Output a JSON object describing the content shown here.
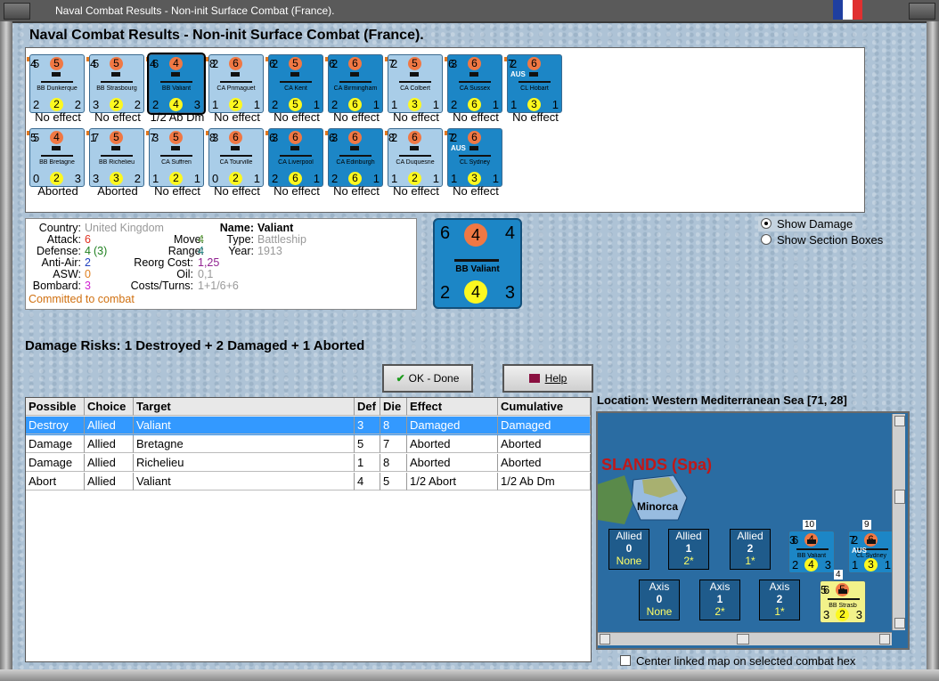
{
  "window": {
    "title": "Naval Combat Results - Non-init Surface Combat (France).",
    "flag_colors": [
      "#1f3fa0",
      "#ffffff",
      "#e03030"
    ]
  },
  "heading": "Naval Combat Results - Non-init Surface Combat (France).",
  "row1": [
    {
      "tl": "5",
      "att": "5",
      "tr": "4",
      "name": "BB Dunkerque",
      "bl": "2",
      "def": "2",
      "br": "2",
      "result": "No effect",
      "style": "light",
      "selected": false
    },
    {
      "tl": "5",
      "att": "5",
      "tr": "4",
      "name": "BB Strasbourg",
      "bl": "3",
      "def": "2",
      "br": "2",
      "result": "No effect",
      "style": "light",
      "selected": false
    },
    {
      "tl": "6",
      "att": "4",
      "tr": "4",
      "name": "BB Valiant",
      "bl": "2",
      "def": "4",
      "br": "3",
      "result": "1/2 Ab Dm",
      "style": "dark",
      "selected": true
    },
    {
      "tl": "2",
      "att": "6",
      "tr": "8",
      "name": "CA Primaguet",
      "bl": "1",
      "def": "2",
      "br": "1",
      "result": "No effect",
      "style": "light",
      "selected": false
    },
    {
      "tl": "2",
      "att": "5",
      "tr": "6",
      "name": "CA Kent",
      "bl": "2",
      "def": "5",
      "br": "1",
      "result": "No effect",
      "style": "dark",
      "selected": false
    },
    {
      "tl": "2",
      "att": "6",
      "tr": "6",
      "name": "CA Birmingham",
      "bl": "2",
      "def": "6",
      "br": "1",
      "result": "No effect",
      "style": "dark",
      "selected": false
    },
    {
      "tl": "2",
      "att": "5",
      "tr": "7",
      "name": "CA Colbert",
      "bl": "1",
      "def": "3",
      "br": "1",
      "result": "No effect",
      "style": "light",
      "selected": false
    },
    {
      "tl": "3",
      "att": "6",
      "tr": "6",
      "name": "CA Sussex",
      "bl": "2",
      "def": "6",
      "br": "1",
      "result": "No effect",
      "style": "dark",
      "selected": false
    },
    {
      "tl": "2",
      "att": "6",
      "tr": "7",
      "name": "CL Hobart",
      "bl": "1",
      "def": "3",
      "br": "1",
      "result": "No effect",
      "style": "dark",
      "selected": false,
      "aus": "AUS"
    }
  ],
  "row2": [
    {
      "tl": "5",
      "att": "4",
      "tr": "5",
      "name": "BB Bretagne",
      "bl": "0",
      "def": "2",
      "br": "3",
      "result": "Aborted",
      "style": "light",
      "selected": false
    },
    {
      "tl": "7",
      "att": "5",
      "tr": "1",
      "name": "BB Richelieu",
      "bl": "3",
      "def": "3",
      "br": "2",
      "result": "Aborted",
      "style": "light",
      "selected": false
    },
    {
      "tl": "3",
      "att": "5",
      "tr": "7",
      "name": "CA Suffren",
      "bl": "1",
      "def": "2",
      "br": "1",
      "result": "No effect",
      "style": "light",
      "selected": false
    },
    {
      "tl": "3",
      "att": "6",
      "tr": "8",
      "name": "CA Tourville",
      "bl": "0",
      "def": "2",
      "br": "1",
      "result": "No effect",
      "style": "light",
      "selected": false
    },
    {
      "tl": "3",
      "att": "6",
      "tr": "6",
      "name": "CA Liverpool",
      "bl": "2",
      "def": "6",
      "br": "1",
      "result": "No effect",
      "style": "dark",
      "selected": false
    },
    {
      "tl": "3",
      "att": "6",
      "tr": "6",
      "name": "CA Edinburgh",
      "bl": "2",
      "def": "6",
      "br": "1",
      "result": "No effect",
      "style": "dark",
      "selected": false
    },
    {
      "tl": "2",
      "att": "6",
      "tr": "8",
      "name": "CA Duquesne",
      "bl": "1",
      "def": "2",
      "br": "1",
      "result": "No effect",
      "style": "light",
      "selected": false
    },
    {
      "tl": "2",
      "att": "6",
      "tr": "7",
      "name": "CL Sydney",
      "bl": "1",
      "def": "3",
      "br": "1",
      "result": "No effect",
      "style": "dark",
      "selected": false,
      "aus": "AUS"
    }
  ],
  "info": {
    "country_label": "Country:",
    "country": "United Kingdom",
    "attack_label": "Attack:",
    "attack": "6",
    "defense_label": "Defense:",
    "defense": "4",
    "defense_extra": "(3)",
    "antiair_label": "Anti-Air:",
    "antiair": "2",
    "asw_label": "ASW:",
    "asw": "0",
    "bombard_label": "Bombard:",
    "bombard": "3",
    "move_label": "Move:",
    "move": "4",
    "range_label": "Range:",
    "range": "4",
    "reorg_label": "Reorg Cost:",
    "reorg": "1,25",
    "oil_label": "Oil:",
    "oil": "0,1",
    "costs_label": "Costs/Turns:",
    "costs": "1+1/6+6",
    "name_label": "Name:",
    "name": "Valiant",
    "type_label": "Type:",
    "type": "Battleship",
    "year_label": "Year:",
    "year": "1913",
    "status": "Committed to combat"
  },
  "big_counter": {
    "tl": "6",
    "att": "4",
    "tr": "4",
    "name": "BB Valiant",
    "bl": "2",
    "def": "4",
    "br": "3"
  },
  "options": {
    "show_damage": "Show Damage",
    "show_section_boxes": "Show Section Boxes"
  },
  "damage_risks": "Damage Risks: 1 Destroyed + 2 Damaged + 1 Aborted",
  "buttons": {
    "ok": "OK - Done",
    "help": "Help"
  },
  "table": {
    "headers": [
      "Possible",
      "Choice",
      "Target",
      "Def",
      "Die",
      "Effect",
      "Cumulative"
    ],
    "rows": [
      [
        "Destroy",
        "Allied",
        "Valiant",
        "3",
        "8",
        "Damaged",
        "Damaged"
      ],
      [
        "Damage",
        "Allied",
        "Bretagne",
        "5",
        "7",
        "Aborted",
        "Aborted"
      ],
      [
        "Damage",
        "Allied",
        "Richelieu",
        "1",
        "8",
        "Aborted",
        "Aborted"
      ],
      [
        "Abort",
        "Allied",
        "Valiant",
        "4",
        "5",
        "1/2 Abort",
        "1/2 Ab Dm"
      ]
    ]
  },
  "map": {
    "location": "Location:  Western Mediterranean Sea [71, 28]",
    "islands_label": "SLANDS (Spa)",
    "minorca": "Minorca",
    "allied": [
      {
        "title": "Allied",
        "num": "0",
        "sub": "None"
      },
      {
        "title": "Allied",
        "num": "1",
        "sub": "2*"
      },
      {
        "title": "Allied",
        "num": "2",
        "sub": "1*"
      }
    ],
    "axis": [
      {
        "title": "Axis",
        "num": "0",
        "sub": "None"
      },
      {
        "title": "Axis",
        "num": "1",
        "sub": "2*"
      },
      {
        "title": "Axis",
        "num": "2",
        "sub": "1*"
      }
    ],
    "stack1": {
      "count": "10",
      "tl": "6",
      "att": "4",
      "tr": "3",
      "name": "BB Valiant",
      "bl": "2",
      "def": "4",
      "br": "3"
    },
    "stack2": {
      "count": "9",
      "tl": "2",
      "att": "6",
      "tr": "7",
      "name": "CL Sydney",
      "bl": "1",
      "def": "3",
      "br": "1",
      "aus": "AUS"
    },
    "stack3": {
      "count": "4",
      "tl": "6",
      "att": "5",
      "tr": "5",
      "name": "BB Strasb",
      "bl": "3",
      "def": "2",
      "br": "3"
    }
  },
  "center_linked": "Center linked map on selected combat hex"
}
